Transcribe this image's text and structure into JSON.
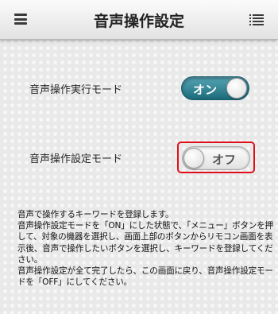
{
  "header": {
    "title": "音声操作設定",
    "menu_icon": "hamburger-menu-icon",
    "list_icon": "list-icon"
  },
  "settings": {
    "execution_mode": {
      "label": "音声操作実行モード",
      "toggle_text": "オン",
      "state": "on"
    },
    "settings_mode": {
      "label": "音声操作設定モード",
      "toggle_text": "オフ",
      "state": "off",
      "highlighted": true
    }
  },
  "description": "音声で操作するキーワードを登録します。\n音声操作設定モードを「ON」にした状態で、「メニュー」ボタンを押して、対象の機器を選択し、画面上部のボタンからリモコン画面を表示後、音声で操作したいボタンを選択し、キーワードを登録してください。\n音声操作設定が全て完了したら、この画面に戻り、音声操作設定モードを「OFF」にしてください。",
  "colors": {
    "toggle_on": "#1b6b7b",
    "highlight": "#e0101a"
  }
}
